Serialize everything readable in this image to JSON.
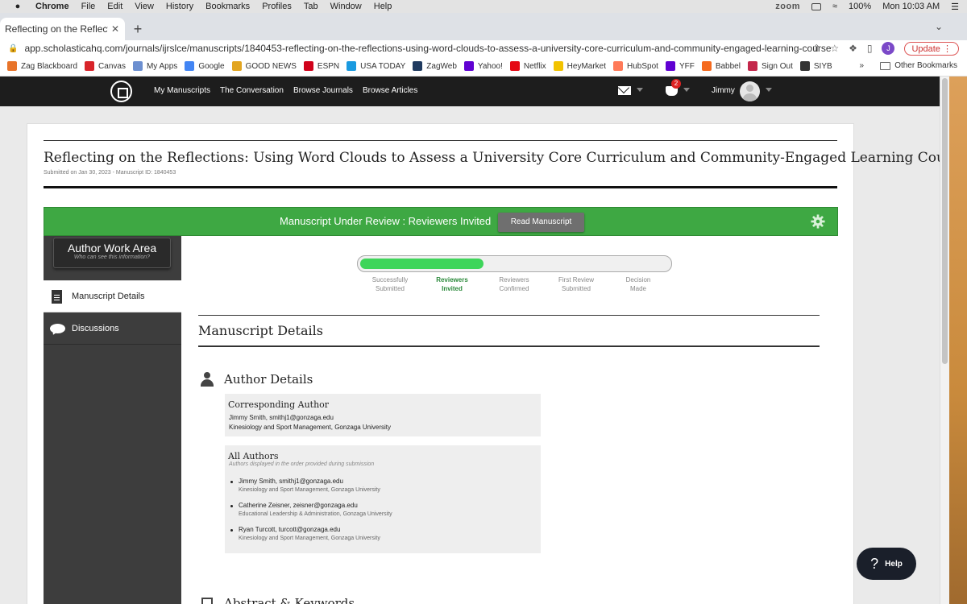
{
  "mac_menu": {
    "app_name": "Chrome",
    "items": [
      "File",
      "Edit",
      "View",
      "History",
      "Bookmarks",
      "Profiles",
      "Tab",
      "Window",
      "Help"
    ],
    "zoom_label": "zoom",
    "battery": "100%",
    "clock": "Mon 10:03 AM"
  },
  "browser": {
    "tab_title": "Reflecting on the Reflections: U",
    "url": "app.scholasticahq.com/journals/ijrslce/manuscripts/1840453-reflecting-on-the-reflections-using-word-clouds-to-assess-a-university-core-curriculum-and-community-engaged-learning-course",
    "profile_initial": "J",
    "update_label": "Update",
    "bookmarks": [
      {
        "label": "Zag Blackboard",
        "color": "#e8742a"
      },
      {
        "label": "Canvas",
        "color": "#d8242a"
      },
      {
        "label": "My Apps",
        "color": "#6c8fd0"
      },
      {
        "label": "Google",
        "color": "#4285f4"
      },
      {
        "label": "GOOD NEWS",
        "color": "#e2a520"
      },
      {
        "label": "ESPN",
        "color": "#d0021b"
      },
      {
        "label": "USA TODAY",
        "color": "#1a9ae0"
      },
      {
        "label": "ZagWeb",
        "color": "#1f3a5f"
      },
      {
        "label": "Yahoo!",
        "color": "#6001d2"
      },
      {
        "label": "Netflix",
        "color": "#e50914"
      },
      {
        "label": "HeyMarket",
        "color": "#f2c300"
      },
      {
        "label": "HubSpot",
        "color": "#ff7a59"
      },
      {
        "label": "YFF",
        "color": "#6001d2"
      },
      {
        "label": "Babbel",
        "color": "#f56a1e"
      },
      {
        "label": "Sign Out",
        "color": "#c4274b"
      },
      {
        "label": "SIYB",
        "color": "#333333"
      }
    ],
    "other_bookmarks": "Other Bookmarks"
  },
  "site_nav": {
    "links": [
      "My Manuscripts",
      "The Conversation",
      "Browse Journals",
      "Browse Articles"
    ],
    "notification_count": "2",
    "user_name": "Jimmy"
  },
  "manuscript": {
    "title": "Reflecting on the Reflections: Using Word Clouds to Assess a University Core Curriculum and Community-Engaged Learning Course",
    "meta": "Submitted on Jan 30, 2023 - Manuscript ID: 1840453"
  },
  "status": {
    "text": "Manuscript Under Review :  Reviewers Invited",
    "read_button": "Read Manuscript",
    "progress_fraction": 0.4,
    "steps": [
      {
        "line1": "Successfully",
        "line2": "Submitted",
        "active": false
      },
      {
        "line1": "Reviewers",
        "line2": "Invited",
        "active": true
      },
      {
        "line1": "Reviewers",
        "line2": "Confirmed",
        "active": false
      },
      {
        "line1": "First Review",
        "line2": "Submitted",
        "active": false
      },
      {
        "line1": "Decision",
        "line2": "Made",
        "active": false
      }
    ],
    "accent_color": "#3ea843"
  },
  "sidebar": {
    "work_area_title": "Author Work Area",
    "work_area_subtitle": "Who can see this information?",
    "items": [
      {
        "label": "Manuscript Details",
        "icon": "document-icon",
        "active": true
      },
      {
        "label": "Discussions",
        "icon": "chat-bubble-icon",
        "active": false
      }
    ]
  },
  "details": {
    "section_title": "Manuscript Details",
    "author_heading": "Author Details",
    "corresponding": {
      "title": "Corresponding Author",
      "name_line": "Jimmy Smith, smithj1@gonzaga.edu",
      "affiliation": "Kinesiology and Sport Management, Gonzaga University"
    },
    "all_authors": {
      "title": "All Authors",
      "note": "Authors displayed in the order provided during submission",
      "authors": [
        {
          "name": "Jimmy Smith, smithj1@gonzaga.edu",
          "affiliation": "Kinesiology and Sport Management, Gonzaga University"
        },
        {
          "name": "Catherine Zeisner, zeisner@gonzaga.edu",
          "affiliation": "Educational Leadership & Administration, Gonzaga University"
        },
        {
          "name": "Ryan Turcott, turcott@gonzaga.edu",
          "affiliation": "Kinesiology and Sport Management, Gonzaga University"
        }
      ]
    },
    "next_heading": "Abstract & Keywords"
  },
  "help": {
    "label": "Help"
  }
}
